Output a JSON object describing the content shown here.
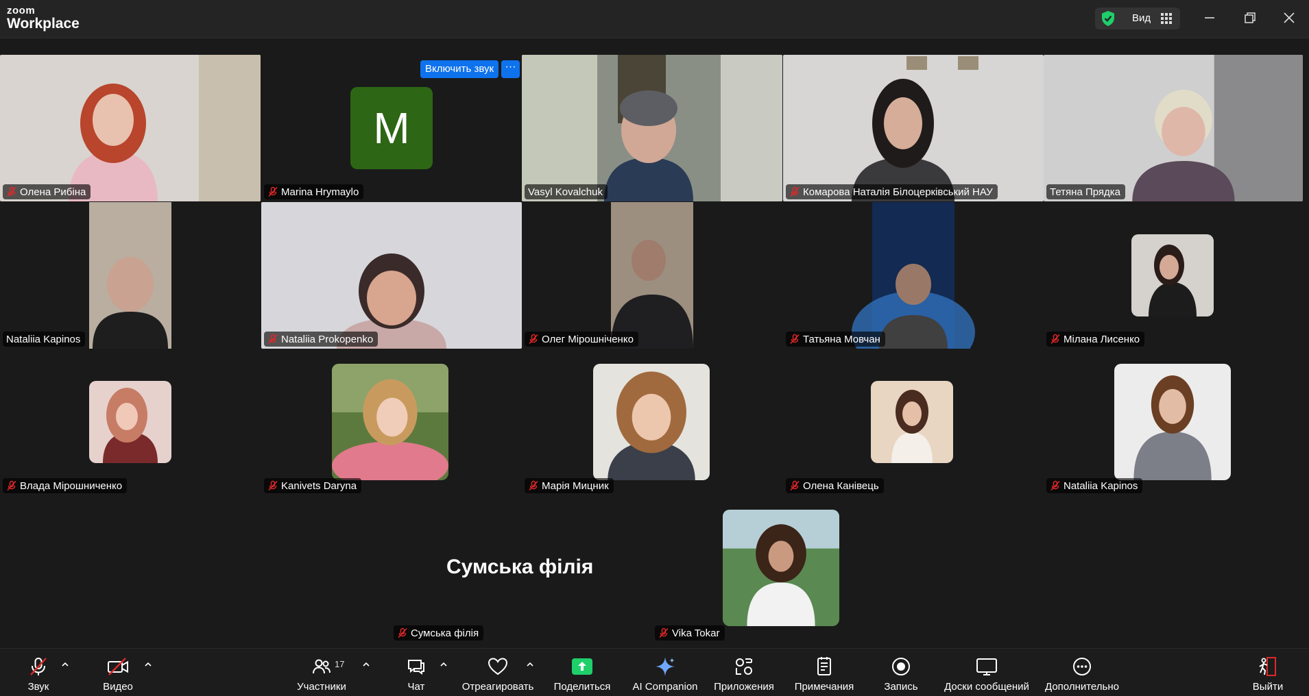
{
  "app": {
    "logo_line1": "zoom",
    "logo_line2": "Workplace",
    "view_label": "Вид"
  },
  "colors": {
    "accent_blue": "#0e72ed",
    "speaking_green": "#23d959",
    "muted_red": "#e02828",
    "share_green": "#1fcf6a"
  },
  "unmute_button": "Включить звук",
  "room_title": "Сумська філія",
  "tiles": [
    {
      "name": "Олена Рибіна"
    },
    {
      "name": "Marina Hrymaylo",
      "avatar_letter": "M"
    },
    {
      "name": "Vasyl Kovalchuk"
    },
    {
      "name": "Комарова Наталія Білоцерківський НАУ"
    },
    {
      "name": "Тетяна Прядка"
    },
    {
      "name": "Nataliia Kapinos"
    },
    {
      "name": "Nataliia Prokopenko"
    },
    {
      "name": "Олег Мірошніченко"
    },
    {
      "name": "Татьяна Мовчан"
    },
    {
      "name": "Мілана Лисенко"
    },
    {
      "name": "Влада Мірошниченко"
    },
    {
      "name": "Kanivets Daryna"
    },
    {
      "name": "Марія Мицник"
    },
    {
      "name": "Олена Канівець"
    },
    {
      "name": "Nataliia Kapinos"
    },
    {
      "name": "Сумська філія"
    },
    {
      "name": "Vika Tokar"
    }
  ],
  "toolbar": {
    "audio": "Звук",
    "video": "Видео",
    "participants": "Участники",
    "participants_count": "17",
    "chat": "Чат",
    "react": "Отреагировать",
    "share": "Поделиться",
    "ai": "AI Companion",
    "apps": "Приложения",
    "notes": "Примечания",
    "record": "Запись",
    "boards": "Доски сообщений",
    "more": "Дополнительно",
    "leave": "Выйти"
  }
}
